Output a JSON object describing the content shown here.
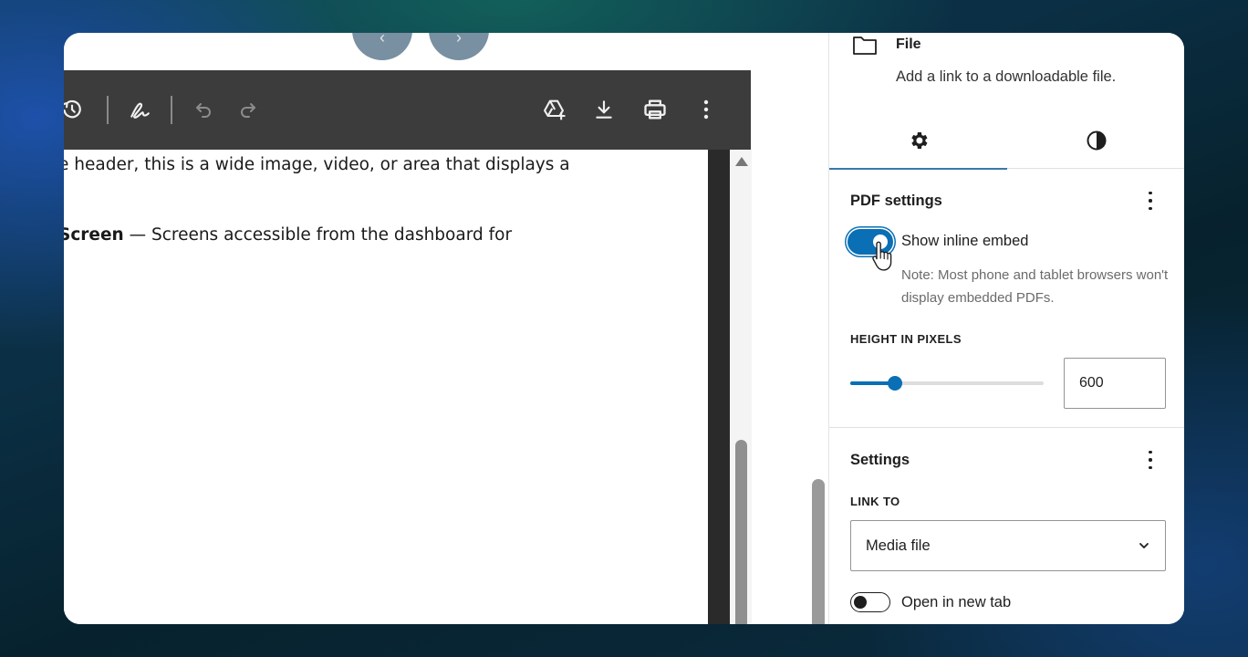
{
  "pdf_viewer": {
    "toolbar": {
      "icons": [
        "rotate-icon",
        "draw-icon",
        "undo-icon",
        "redo-icon",
        "add-to-drive-icon",
        "download-icon",
        "print-icon",
        "more-options-icon"
      ]
    },
    "content": {
      "line1": "e header, this is a wide image, video, or area that displays a",
      "line2_bold": "Screen",
      "line2_rest": " — Screens accessible from the dashboard for"
    }
  },
  "sidebar": {
    "block": {
      "title": "File",
      "description": "Add a link to a downloadable file."
    },
    "tabs": [
      {
        "icon": "gear-icon",
        "active": true
      },
      {
        "icon": "contrast-icon",
        "active": false
      }
    ],
    "pdf_settings": {
      "title": "PDF settings",
      "show_inline_embed_label": "Show inline embed",
      "show_inline_embed_on": true,
      "note": "Note: Most phone and tablet browsers won't display embedded PDFs.",
      "height_label": "HEIGHT IN PIXELS",
      "height_value": "600",
      "height_slider_fraction": 0.23
    },
    "settings": {
      "title": "Settings",
      "link_to_label": "LINK TO",
      "link_to_value": "Media file",
      "open_new_tab_label": "Open in new tab",
      "open_new_tab_on": false
    }
  },
  "colors": {
    "accent": "#0a6fb5",
    "tab_indicator": "#3b78a8",
    "toolbar_bg": "#3c3c3c"
  }
}
